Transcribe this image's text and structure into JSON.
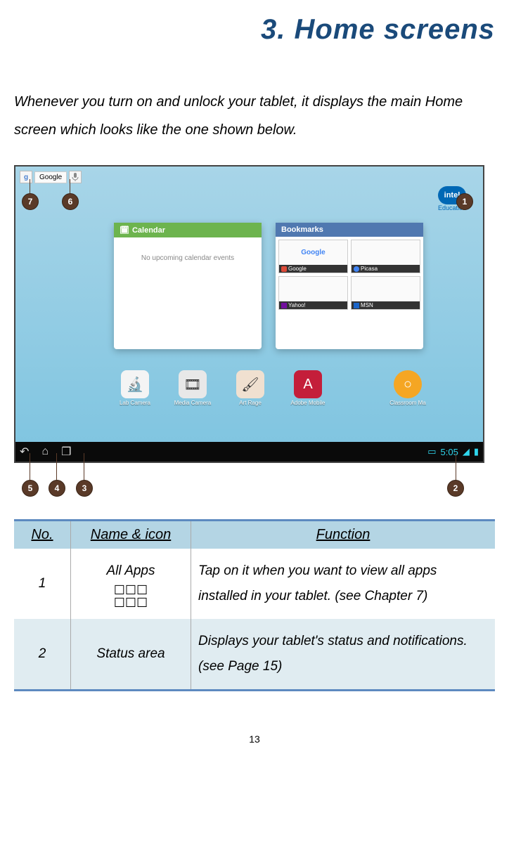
{
  "chapter_title": "3. Home screens",
  "intro": "Whenever you turn on and unlock your tablet, it displays the main Home screen which looks like the one shown below.",
  "topbar": {
    "google_text": "Google"
  },
  "intel": {
    "brand": "intel",
    "sub": "Education"
  },
  "widgets": {
    "calendar": {
      "title": "Calendar",
      "body": "No upcoming calendar events"
    },
    "bookmarks": {
      "title": "Bookmarks",
      "items": [
        "Google",
        "Picasa",
        "Yahoo!",
        "MSN"
      ],
      "thumbs": [
        "Google",
        "",
        "",
        ""
      ]
    }
  },
  "dock": [
    "Lab Camera",
    "Media Camera",
    "Art Rage",
    "Adobe Mobile",
    "Classroom Ma"
  ],
  "statusbar": {
    "time": "5:05"
  },
  "callouts": [
    "1",
    "2",
    "3",
    "4",
    "5",
    "6",
    "7"
  ],
  "table": {
    "headers": [
      "No.",
      "Name & icon",
      "Function"
    ],
    "rows": [
      {
        "no": "1",
        "name": "All Apps",
        "icon": "☐☐☐\n☐☐☐",
        "func": "Tap on it when you want to view all apps installed in your tablet. (see Chapter 7)"
      },
      {
        "no": "2",
        "name": "Status area",
        "func": "Displays your tablet's status and notifications. (see Page 15)"
      }
    ]
  },
  "page_number": "13"
}
